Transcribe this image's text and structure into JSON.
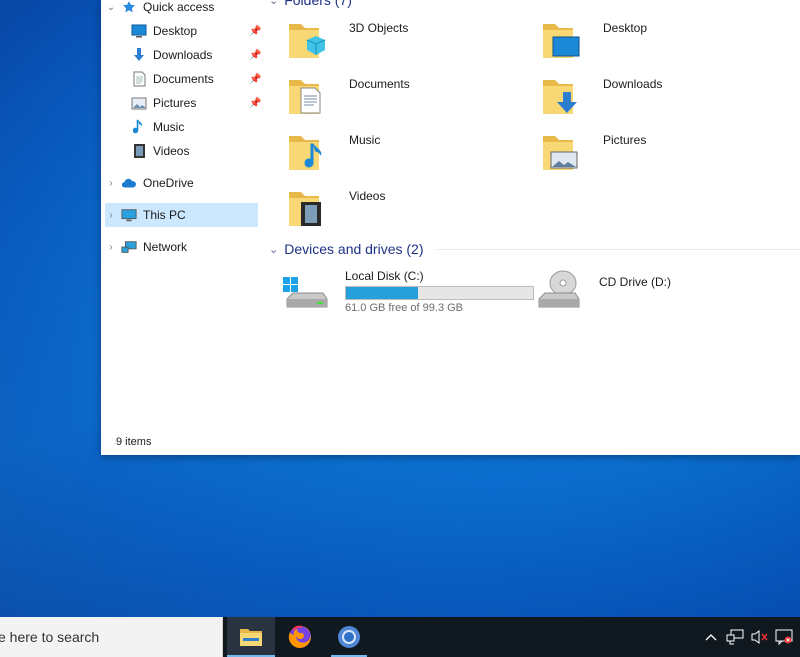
{
  "nav": {
    "quick_access": "Quick access",
    "quick_items": [
      {
        "label": "Desktop",
        "icon": "desktop-icon"
      },
      {
        "label": "Downloads",
        "icon": "download-arrow-icon"
      },
      {
        "label": "Documents",
        "icon": "document-icon"
      },
      {
        "label": "Pictures",
        "icon": "pictures-icon"
      },
      {
        "label": "Music",
        "icon": "music-note-icon"
      },
      {
        "label": "Videos",
        "icon": "film-icon"
      }
    ],
    "onedrive": "OneDrive",
    "this_pc": "This PC",
    "network": "Network"
  },
  "content": {
    "folders_header": "Folders (7)",
    "folders": [
      {
        "name": "3D Objects",
        "icon": "3d-objects-folder-icon"
      },
      {
        "name": "Desktop",
        "icon": "desktop-folder-icon"
      },
      {
        "name": "Documents",
        "icon": "documents-folder-icon"
      },
      {
        "name": "Downloads",
        "icon": "downloads-folder-icon"
      },
      {
        "name": "Music",
        "icon": "music-folder-icon"
      },
      {
        "name": "Pictures",
        "icon": "pictures-folder-icon"
      },
      {
        "name": "Videos",
        "icon": "videos-folder-icon"
      }
    ],
    "devices_header": "Devices and drives (2)",
    "drives": [
      {
        "name": "Local Disk (C:)",
        "free_text": "61.0 GB free of 99.3 GB",
        "used_fraction": 0.386
      },
      {
        "name": "CD Drive (D:)"
      }
    ]
  },
  "status": {
    "items": "9 items"
  },
  "taskbar": {
    "search_placeholder": "Type here to search",
    "search_visible": "e here to search",
    "apps": [
      {
        "name": "File Explorer",
        "icon": "file-explorer-icon",
        "state": "active"
      },
      {
        "name": "Firefox",
        "icon": "firefox-icon",
        "state": "pinned"
      },
      {
        "name": "Chrome",
        "icon": "chrome-icon",
        "state": "running"
      }
    ],
    "tray_icons": [
      "chevron-up-icon",
      "network-icon",
      "volume-muted-icon",
      "notification-icon"
    ]
  },
  "colors": {
    "accent": "#26a0da",
    "selection": "#cce8ff",
    "group_header": "#1e3287",
    "taskbar": "#101820"
  }
}
